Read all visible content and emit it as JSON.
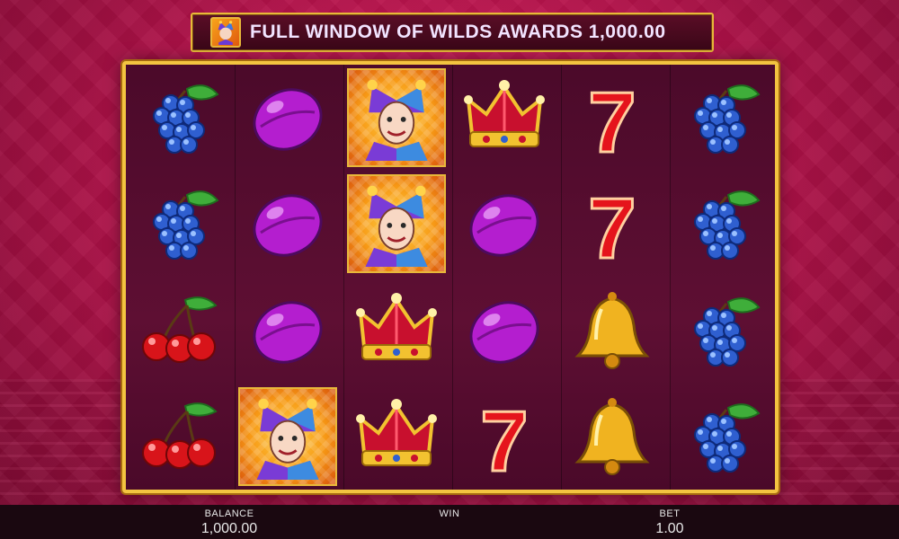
{
  "banner": {
    "text": "FULL WINDOW OF WILDS AWARDS 1,000.00",
    "icon": "jester-icon"
  },
  "reels": [
    [
      "grapes",
      "grapes",
      "cherries",
      "cherries"
    ],
    [
      "plum",
      "plum",
      "plum",
      "jester"
    ],
    [
      "jester",
      "jester",
      "crown",
      "crown"
    ],
    [
      "crown",
      "plum",
      "plum",
      "seven"
    ],
    [
      "seven",
      "seven",
      "bell",
      "bell"
    ],
    [
      "grapes",
      "grapes",
      "grapes",
      "grapes"
    ]
  ],
  "footer": {
    "balance_label": "BALANCE",
    "balance_value": "1,000.00",
    "win_label": "WIN",
    "bet_label": "BET",
    "bet_value": "1.00"
  },
  "colors": {
    "background": "#b3124a",
    "frame_gold": "#f3c440",
    "banner_text": "#f2e4ff"
  }
}
